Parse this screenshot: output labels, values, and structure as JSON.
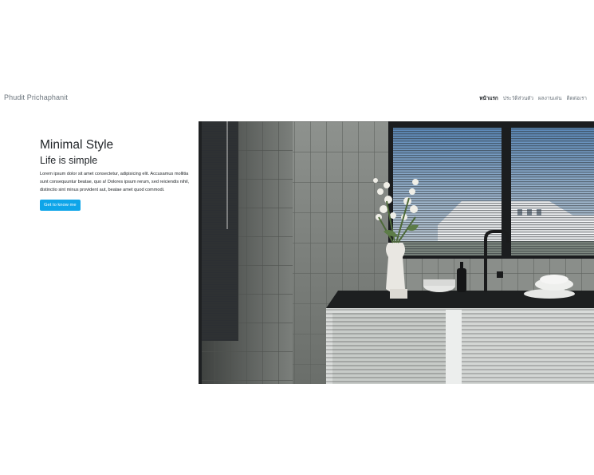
{
  "brand": {
    "name": "Phudit Prichaphanit"
  },
  "nav": {
    "items": [
      {
        "label": "หน้าแรก",
        "active": true
      },
      {
        "label": "ประวัติส่วนตัว",
        "active": false
      },
      {
        "label": "ผลงานเด่น",
        "active": false
      },
      {
        "label": "ติดต่อเรา",
        "active": false
      }
    ]
  },
  "hero": {
    "title": "Minimal Style",
    "subtitle": "Life is simple",
    "description": "Lorem ipsum dolor sit amet consectetur, adipisicing elit. Accusamus mollitia sunt consequuntur beatae, quo a! Dolores ipsum rerum, sed reiciendis nihil, distinctio sint minus provident aut, beatae amet quod commodi.",
    "button_label": "Get to know me",
    "accent_color": "#0ea5e9"
  },
  "image": {
    "subject": "minimal kitchen with window blinds, tiled wall and white vase of flowers"
  }
}
